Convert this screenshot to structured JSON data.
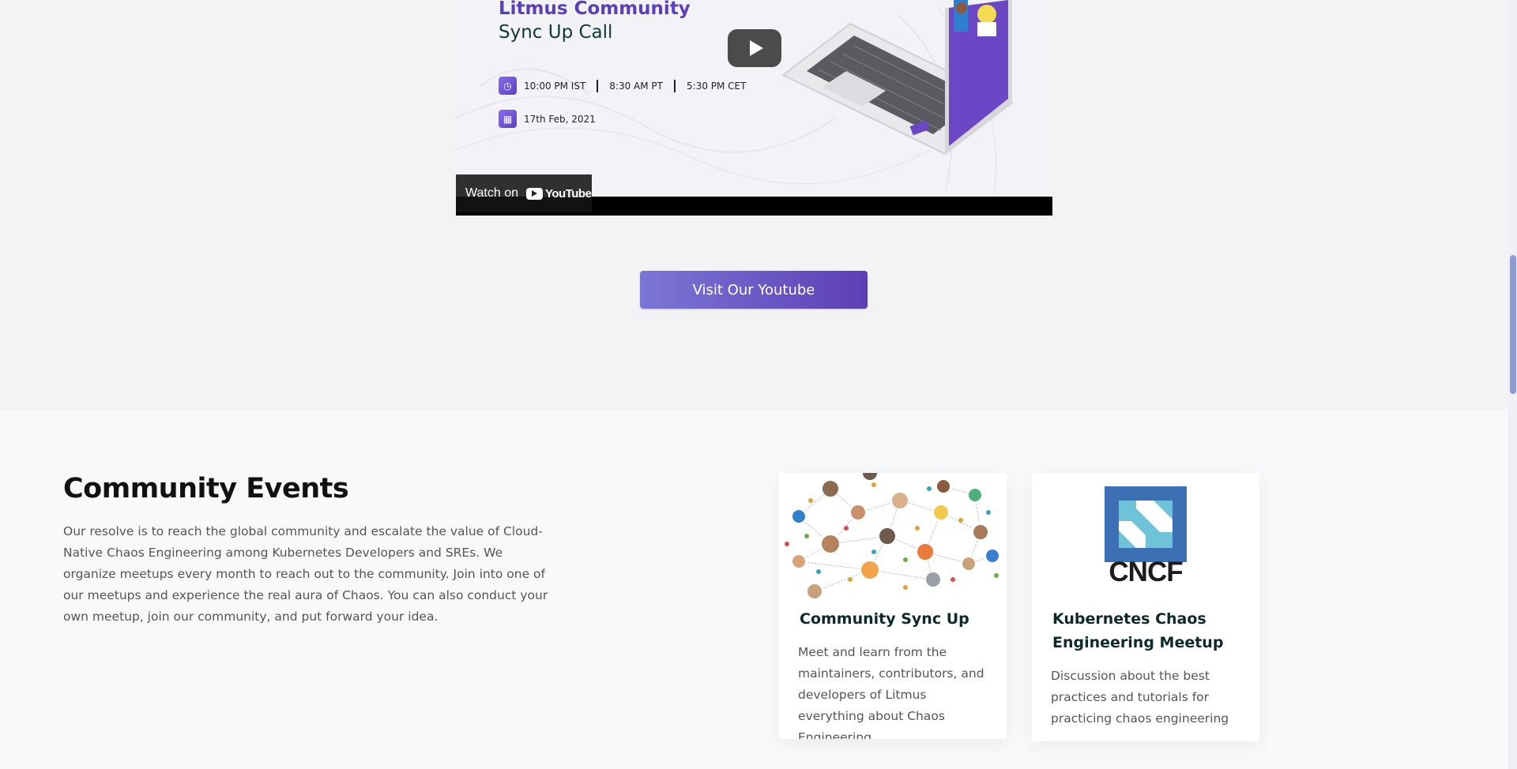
{
  "video": {
    "title_line1": "Litmus Community",
    "title_line2": "Sync Up Call",
    "times": [
      "10:00 PM IST",
      "8:30 AM PT",
      "5:30 PM CET"
    ],
    "date": "17th Feb, 2021",
    "watch_on_label": "Watch on",
    "youtube_label": "YouTube",
    "play_icon": "play-icon"
  },
  "visit_button": "Visit Our Youtube",
  "community_events": {
    "title": "Community Events",
    "description": "Our resolve is to reach the global community and escalate the value of Cloud-Native Chaos Engineering among Kubernetes Developers and SREs. We organize meetups every month to reach out to the community. Join into one of our meetups and experience the real aura of Chaos. You can also conduct your own meetup, join our community, and put forward your idea.",
    "cards": [
      {
        "title": "Community Sync Up",
        "text": "Meet and learn from the maintainers, contributors, and developers of Litmus everything about Chaos Engineering."
      },
      {
        "title": "Kubernetes Chaos Engineering Meetup",
        "text": "Discussion about the best practices and tutorials for practicing chaos engineering",
        "logo_text": "CNCF"
      }
    ]
  },
  "colors": {
    "accent": "#5c3fb5",
    "button_gradient_start": "#7c76d6",
    "title_purple": "#5b3fb8",
    "cncf_blue_dark": "#3d6fb5",
    "cncf_blue_light": "#6ec3d9"
  }
}
